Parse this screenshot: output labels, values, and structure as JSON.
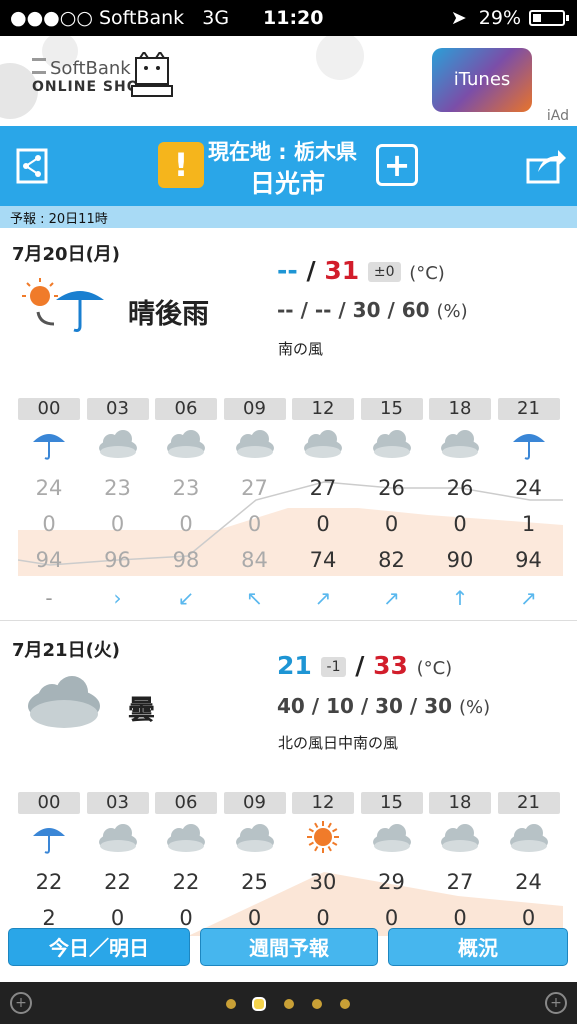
{
  "status_bar": {
    "signal": "●●●○○",
    "carrier": "SoftBank",
    "network": "3G",
    "time": "11:20",
    "battery": "29%"
  },
  "ad": {
    "brand_line1": "SoftBank",
    "brand_line2": "ONLINE SHOP",
    "itunes": "iTunes",
    "iad": "iAd"
  },
  "header": {
    "location_line": "現在地 : 栃木県",
    "city": "日光市"
  },
  "forecast_time": "予報 : 20日11時",
  "days": [
    {
      "date": "7月20日(月)",
      "weather": "晴後雨",
      "temp_low": "--",
      "temp_high": "31",
      "diff": "±0",
      "temp_unit": "(°C)",
      "pop": "-- / -- / 30 / 60",
      "pop_unit": "(%)",
      "wind": "南の風",
      "hours": [
        "00",
        "03",
        "06",
        "09",
        "12",
        "15",
        "18",
        "21"
      ],
      "hour_icons": [
        "umbrella-icon",
        "cloud-icon",
        "cloud-icon",
        "cloud-icon",
        "cloud-icon",
        "cloud-icon",
        "cloud-icon",
        "umbrella-icon"
      ],
      "temps": [
        "24",
        "23",
        "23",
        "27",
        "27",
        "26",
        "26",
        "24"
      ],
      "precip": [
        "0",
        "0",
        "0",
        "0",
        "0",
        "0",
        "0",
        "1"
      ],
      "humidity": [
        "94",
        "96",
        "98",
        "84",
        "74",
        "82",
        "90",
        "94"
      ],
      "wind_dirs": [
        "-",
        "›",
        "↙",
        "↖",
        "↗",
        "↗",
        "↑",
        "↗"
      ]
    },
    {
      "date": "7月21日(火)",
      "weather": "曇",
      "temp_low": "21",
      "temp_high": "33",
      "diff": "-1",
      "temp_unit": "(°C)",
      "pop": "40 / 10 / 30 / 30",
      "pop_unit": "(%)",
      "wind": "北の風日中南の風",
      "hours": [
        "00",
        "03",
        "06",
        "09",
        "12",
        "15",
        "18",
        "21"
      ],
      "hour_icons": [
        "umbrella-icon",
        "cloud-icon",
        "cloud-icon",
        "cloud-icon",
        "sun-icon",
        "cloud-icon",
        "cloud-icon",
        "cloud-icon"
      ],
      "temps": [
        "22",
        "22",
        "22",
        "25",
        "30",
        "29",
        "27",
        "24"
      ],
      "precip": [
        "2",
        "0",
        "0",
        "0",
        "0",
        "0",
        "0",
        "0"
      ]
    }
  ],
  "tabs": [
    "今日／明日",
    "週間予報",
    "概況"
  ],
  "colors": {
    "accent": "#2aa6e8",
    "high": "#d21d2b",
    "low": "#1e95d4"
  }
}
